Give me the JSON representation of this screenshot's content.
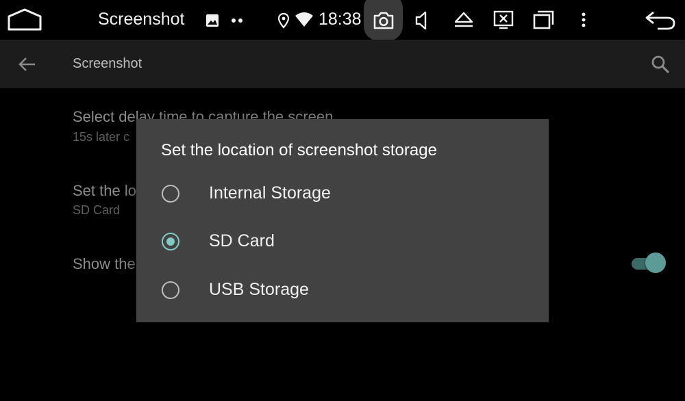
{
  "statusbar": {
    "title": "Screenshot",
    "time": "18:38"
  },
  "toolbar": {
    "title": "Screenshot"
  },
  "preferences": [
    {
      "title": "Select delay time to capture the screen",
      "summary": "15s later c"
    },
    {
      "title": "Set the lo",
      "summary": "SD Card"
    },
    {
      "title": "Show the"
    }
  ],
  "dialog": {
    "title": "Set the location of screenshot storage",
    "options": [
      {
        "label": "Internal Storage",
        "checked": false
      },
      {
        "label": "SD Card",
        "checked": true
      },
      {
        "label": "USB Storage",
        "checked": false
      }
    ]
  },
  "colors": {
    "accent": "#80cbc4",
    "dialog_bg": "#424242",
    "toolbar_bg": "#1c1c1c"
  },
  "icons": [
    "home-icon",
    "image-icon",
    "more-dots-icon",
    "location-icon",
    "wifi-icon",
    "camera-icon",
    "volume-icon",
    "eject-icon",
    "screen-cancel-icon",
    "recent-apps-icon",
    "overflow-menu-icon",
    "back-nav-icon",
    "back-arrow-icon",
    "search-icon"
  ]
}
